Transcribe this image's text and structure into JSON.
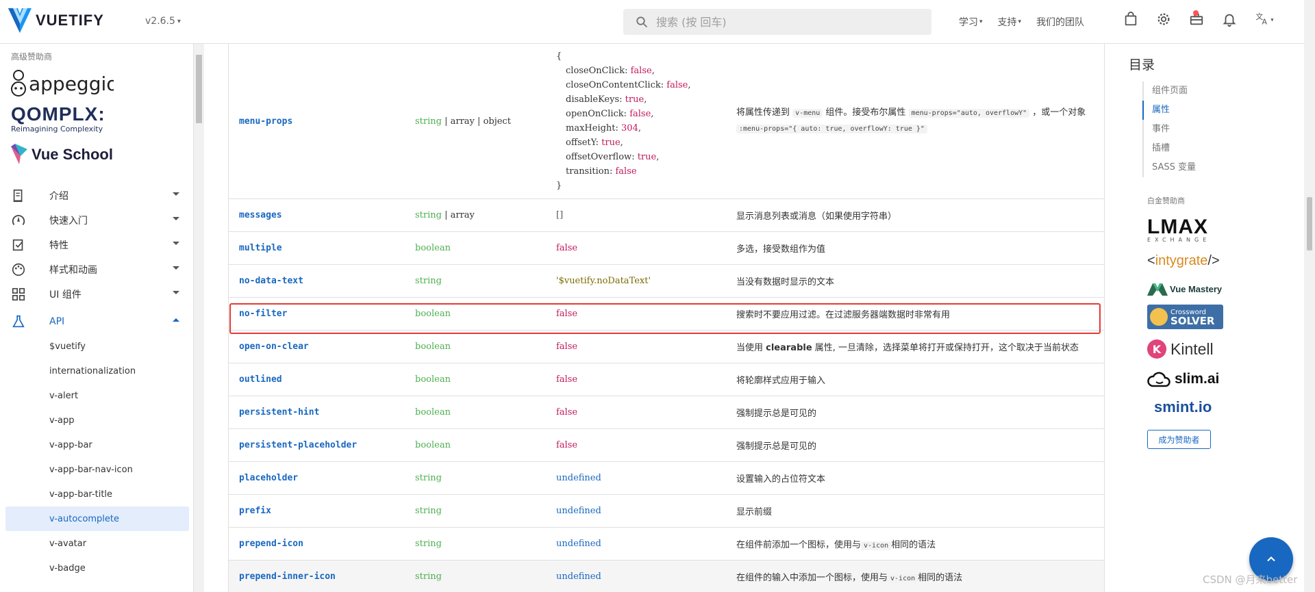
{
  "header": {
    "brand": "VUETIFY",
    "version": "v2.6.5",
    "search_placeholder": "搜索 (按 回车)",
    "links": [
      "学习",
      "支持",
      "我们的团队"
    ],
    "icons": [
      "shopping-bag-icon",
      "gear-icon",
      "briefcase-icon",
      "bell-icon",
      "translate-icon"
    ]
  },
  "sidebar": {
    "sponsor_label": "高级赞助商",
    "sponsors": {
      "appeggio": "appeggio",
      "qomplx": "QOMPLX:",
      "qomplx_sub": "Reimagining Complexity",
      "vueschool": "Vue School"
    },
    "nav": [
      {
        "label": "介绍",
        "icon": "book-icon"
      },
      {
        "label": "快速入门",
        "icon": "speed-icon"
      },
      {
        "label": "特性",
        "icon": "feature-icon"
      },
      {
        "label": "样式和动画",
        "icon": "palette-icon"
      },
      {
        "label": "UI 组件",
        "icon": "grid-icon"
      },
      {
        "label": "API",
        "icon": "flask-icon"
      }
    ],
    "api_items": [
      "$vuetify",
      "internationalization",
      "v-alert",
      "v-app",
      "v-app-bar",
      "v-app-bar-nav-icon",
      "v-app-bar-title",
      "v-autocomplete",
      "v-avatar",
      "v-badge"
    ],
    "active_item": "v-autocomplete"
  },
  "table": {
    "menu_props": {
      "name": "menu-props",
      "type_parts": [
        "string",
        "array",
        "object"
      ],
      "default_lines": [
        {
          "k": "closeOnClick",
          "v": "false"
        },
        {
          "k": "closeOnContentClick",
          "v": "false"
        },
        {
          "k": "disableKeys",
          "v": "true"
        },
        {
          "k": "openOnClick",
          "v": "false"
        },
        {
          "k": "maxHeight",
          "v": "304"
        },
        {
          "k": "offsetY",
          "v": "true"
        },
        {
          "k": "offsetOverflow",
          "v": "true"
        },
        {
          "k": "transition",
          "v": "false"
        }
      ],
      "desc_a": "将属性传递到",
      "desc_chip1": "v-menu",
      "desc_b": "组件。接受布尔属性",
      "desc_chip2": "menu-props=\"auto, overflowY\"",
      "desc_c": "，或一个对象",
      "desc_chip3": ":menu-props=\"{ auto: true, overflowY: true }\""
    },
    "messages": {
      "name": "messages",
      "type_a": "string",
      "type_b": "array",
      "default": "[]",
      "desc": "显示消息列表或消息（如果使用字符串）"
    },
    "rows": [
      {
        "name": "multiple",
        "type": "boolean",
        "default": "false",
        "desc": "多选，接受数组作为值"
      },
      {
        "name": "no-data-text",
        "type": "string",
        "default": "'$vuetify.noDataText'",
        "desc": "当没有数据时显示的文本"
      },
      {
        "name": "no-filter",
        "type": "boolean",
        "default": "false",
        "desc": "搜索时不要应用过滤。在过滤服务器端数据时非常有用"
      },
      {
        "name": "open-on-clear",
        "type": "boolean",
        "default": "false",
        "desc_a": "当使用 ",
        "desc_bold": "clearable",
        "desc_b": " 属性, 一旦清除，选择菜单将打开或保持打开，这个取决于当前状态"
      },
      {
        "name": "outlined",
        "type": "boolean",
        "default": "false",
        "desc": "将轮廓样式应用于输入"
      },
      {
        "name": "persistent-hint",
        "type": "boolean",
        "default": "false",
        "desc": "强制提示总是可见的"
      },
      {
        "name": "persistent-placeholder",
        "type": "boolean",
        "default": "false",
        "desc": "强制提示总是可见的"
      },
      {
        "name": "placeholder",
        "type": "string",
        "default": "undefined",
        "desc": "设置输入的占位符文本"
      },
      {
        "name": "prefix",
        "type": "string",
        "default": "undefined",
        "desc": "显示前缀"
      },
      {
        "name": "prepend-icon",
        "type": "string",
        "default": "undefined",
        "desc_a": "在组件前添加一个图标，使用与",
        "desc_chip": "v-icon",
        "desc_b": "相同的语法"
      },
      {
        "name": "prepend-inner-icon",
        "type": "string",
        "default": "undefined",
        "desc_a": "在组件的输入中添加一个图标，使用与",
        "desc_chip": "v-icon",
        "desc_b": "相同的语法"
      }
    ]
  },
  "toc": {
    "title": "目录",
    "items": [
      "组件页面",
      "属性",
      "事件",
      "插槽",
      "SASS 变量"
    ],
    "active": "属性"
  },
  "gold": {
    "label": "白金赞助商",
    "lmax": "LMAX",
    "lmax_sub": "EXCHANGE",
    "intygrate": "intygrate",
    "vuemastery": "Vue Mastery",
    "crossword_a": "Crossword",
    "crossword_b": "SOLVER",
    "kintell": "Kintell",
    "slim": "slim.ai",
    "smint": "smint.io",
    "become": "成为赞助者"
  },
  "watermark": "CSDN @月来better",
  "colors": {
    "primary": "#1867c0",
    "boolean": "#4caf50",
    "value": "#c2185b",
    "highlight": "#e53935"
  }
}
